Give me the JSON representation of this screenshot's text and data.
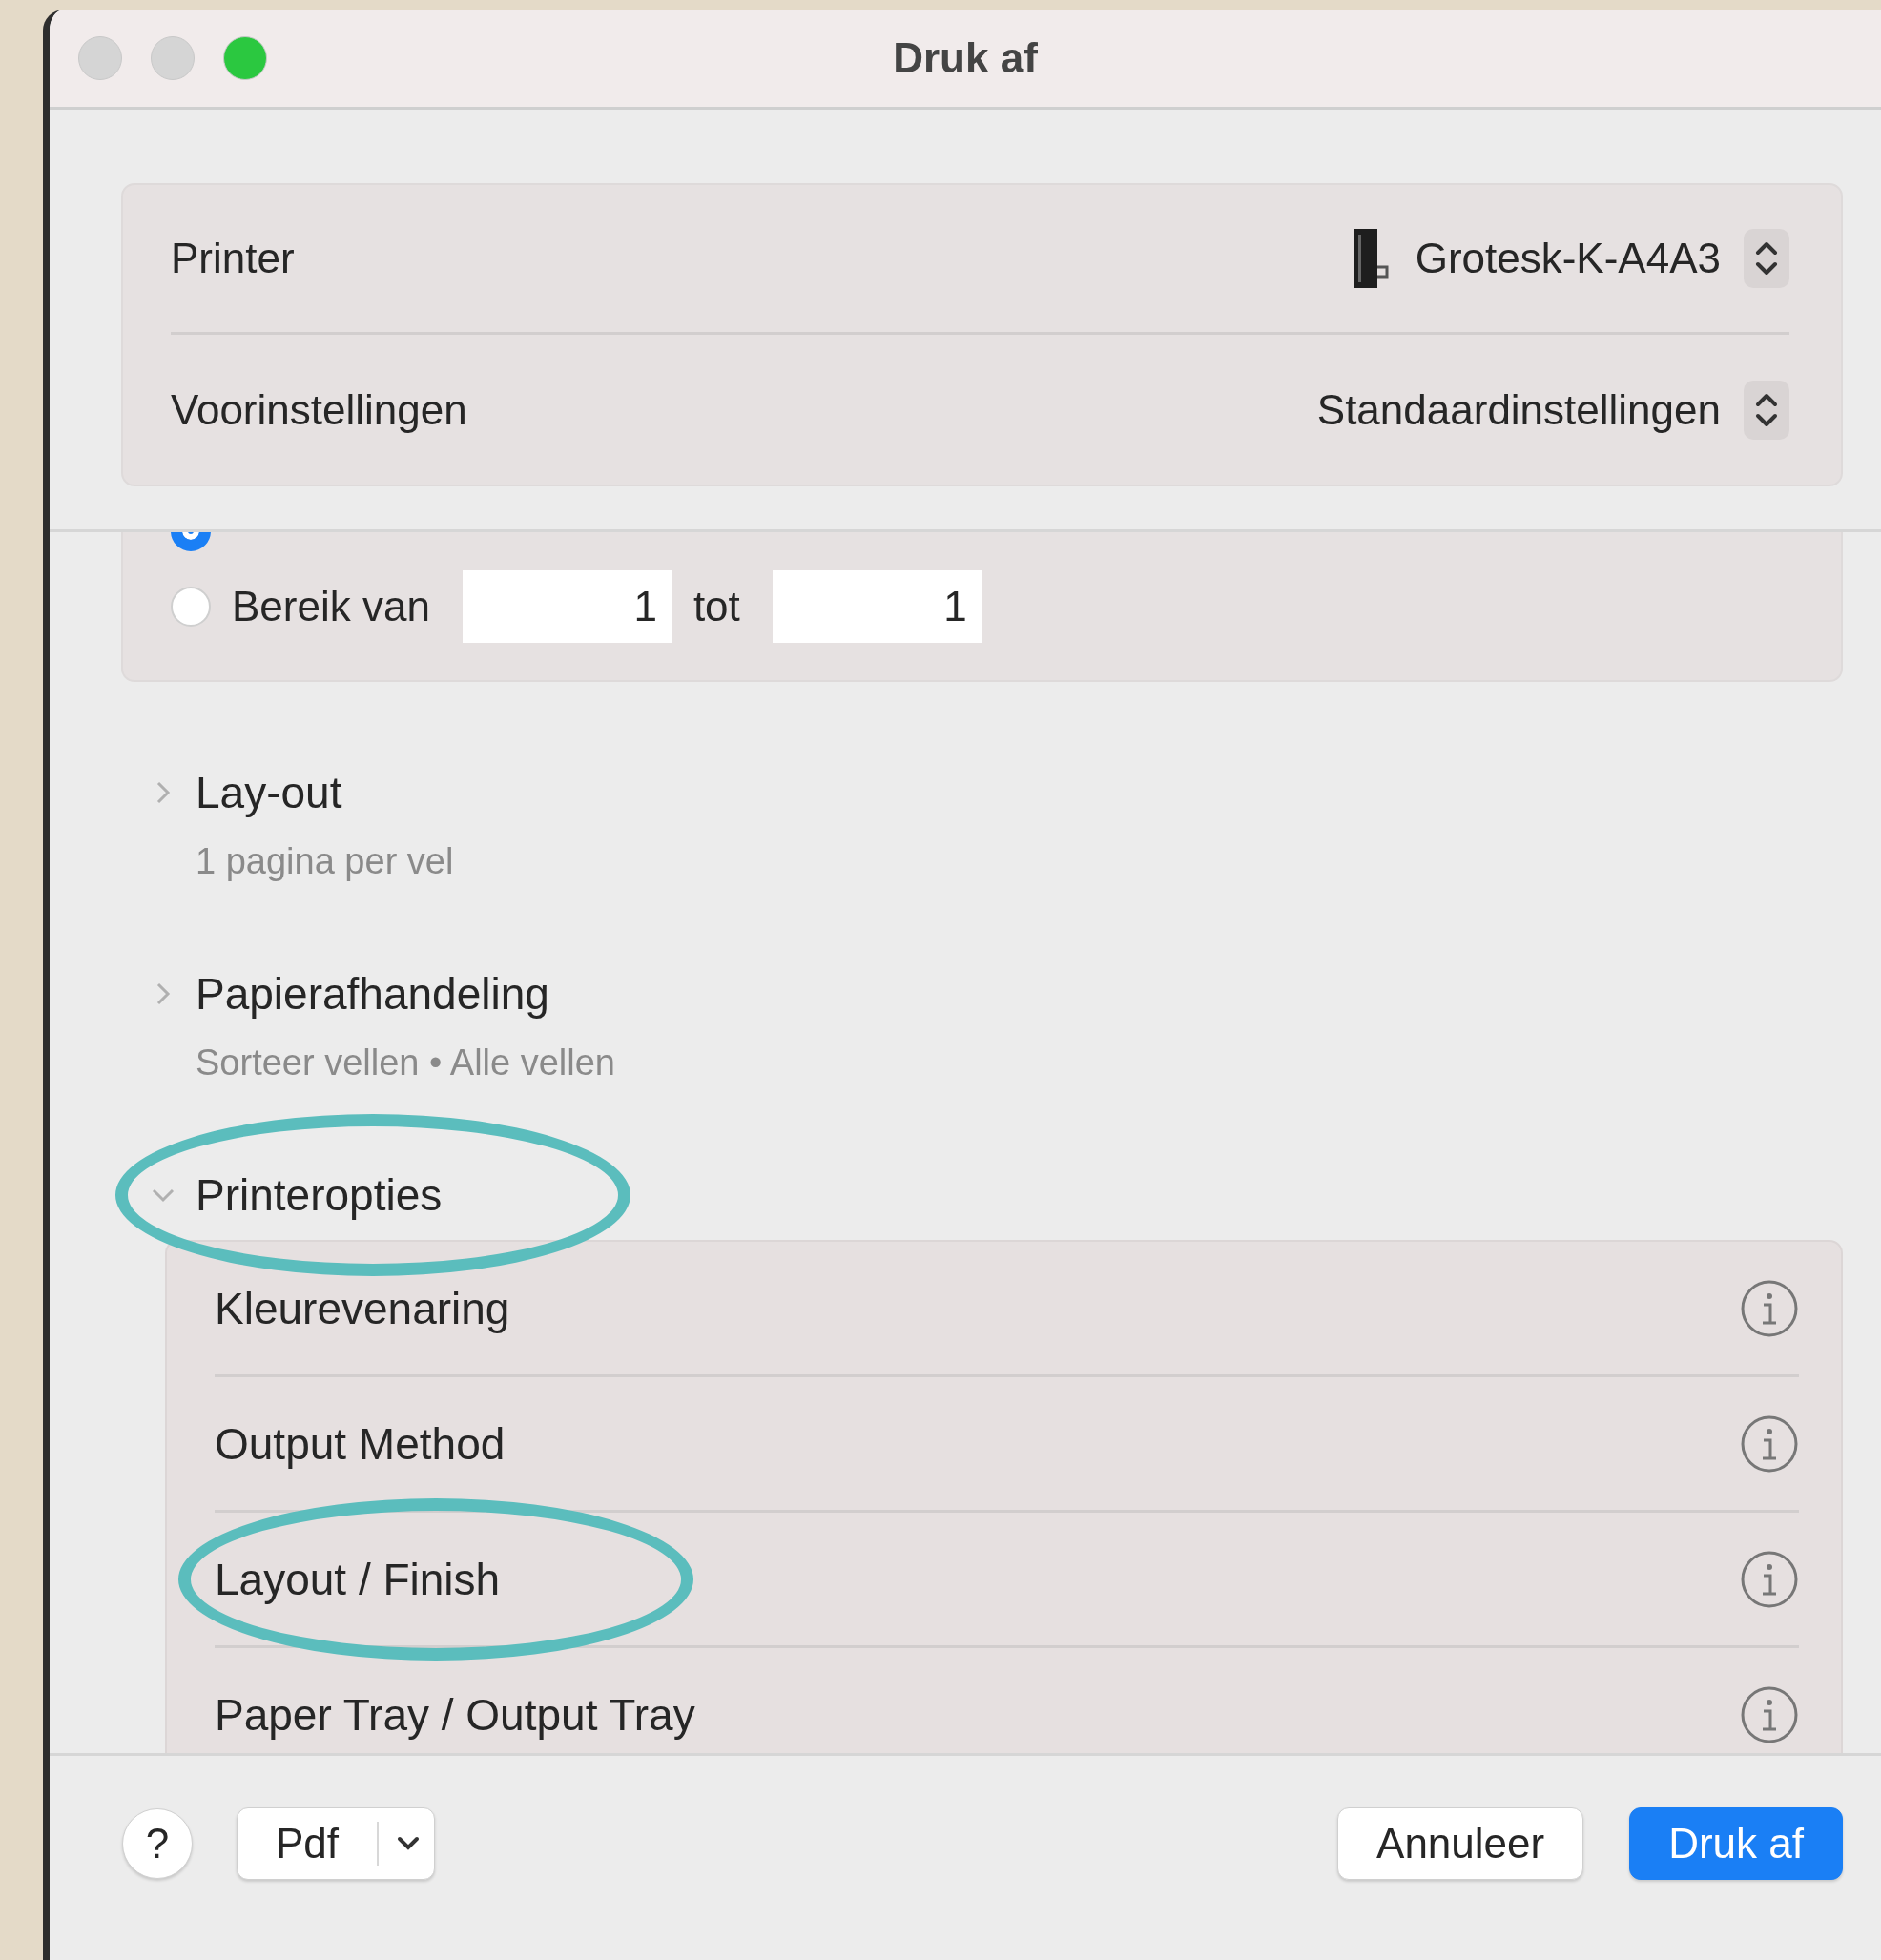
{
  "window": {
    "title": "Druk af"
  },
  "header": {
    "rows": [
      {
        "label": "Printer",
        "value": "Grotesk-K-A4A3",
        "kind": "printer"
      },
      {
        "label": "Voorinstellingen",
        "value": "Standaardinstellingen",
        "kind": "plain"
      }
    ]
  },
  "pages": {
    "options": [
      {
        "selected": true
      },
      {
        "label": "Bereik van",
        "selected": false
      }
    ],
    "from": "1",
    "to_label": "tot",
    "to": "1"
  },
  "sections": [
    {
      "title": "Lay-out",
      "summary": "1 pagina per vel",
      "expanded": false,
      "highlighted": false
    },
    {
      "title": "Papierafhandeling",
      "summary": "Sorteer vellen • Alle vellen",
      "expanded": false,
      "highlighted": false
    },
    {
      "title": "Printeropties",
      "expanded": true,
      "highlighted": true,
      "items": [
        {
          "label": "Kleurevenaring",
          "highlighted": false
        },
        {
          "label": "Output Method",
          "highlighted": false
        },
        {
          "label": "Layout / Finish",
          "highlighted": true
        },
        {
          "label": "Paper Tray / Output Tray",
          "highlighted": false
        }
      ]
    }
  ],
  "footer": {
    "help": "?",
    "pdf": "Pdf",
    "cancel": "Annuleer",
    "confirm": "Druk af"
  }
}
